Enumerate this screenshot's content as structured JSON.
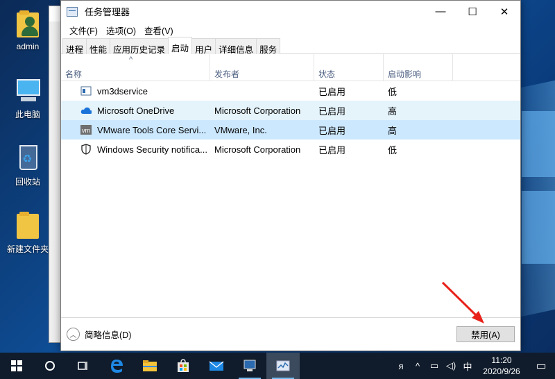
{
  "desktop": {
    "icons": [
      {
        "label": "admin"
      },
      {
        "label": "此电脑"
      },
      {
        "label": "回收站"
      },
      {
        "label": "新建文件夹"
      }
    ]
  },
  "window": {
    "title": "任务管理器",
    "minimize_glyph": "—",
    "maximize_glyph": "☐",
    "close_glyph": "✕"
  },
  "menu": [
    "文件(F)",
    "选项(O)",
    "查看(V)"
  ],
  "tabs": [
    "进程",
    "性能",
    "应用历史记录",
    "启动",
    "用户",
    "详细信息",
    "服务"
  ],
  "active_tab": "启动",
  "columns": {
    "name": "名称",
    "publisher": "发布者",
    "status": "状态",
    "impact": "启动影响",
    "sort_glyph": "^"
  },
  "rows": [
    {
      "name": "vm3dservice",
      "publisher": "",
      "status": "已启用",
      "impact": "低",
      "icon": "service-window-icon"
    },
    {
      "name": "Microsoft OneDrive",
      "publisher": "Microsoft Corporation",
      "status": "已启用",
      "impact": "高",
      "icon": "onedrive-cloud-icon"
    },
    {
      "name": "VMware Tools Core Servi...",
      "publisher": "VMware, Inc.",
      "status": "已启用",
      "impact": "高",
      "icon": "vmware-icon"
    },
    {
      "name": "Windows Security notifica...",
      "publisher": "Microsoft Corporation",
      "status": "已启用",
      "impact": "低",
      "icon": "shield-icon"
    }
  ],
  "footer": {
    "fewer_details": "简略信息(D)",
    "disable_button": "禁用(A)"
  },
  "taskbar": {
    "ime": "中",
    "time": "11:20",
    "date": "2020/9/26"
  },
  "colors": {
    "selected_row": "#cce8ff",
    "hover_row": "#e5f3fb",
    "arrow": "#e8221b",
    "taskbar": "#101c2c"
  }
}
